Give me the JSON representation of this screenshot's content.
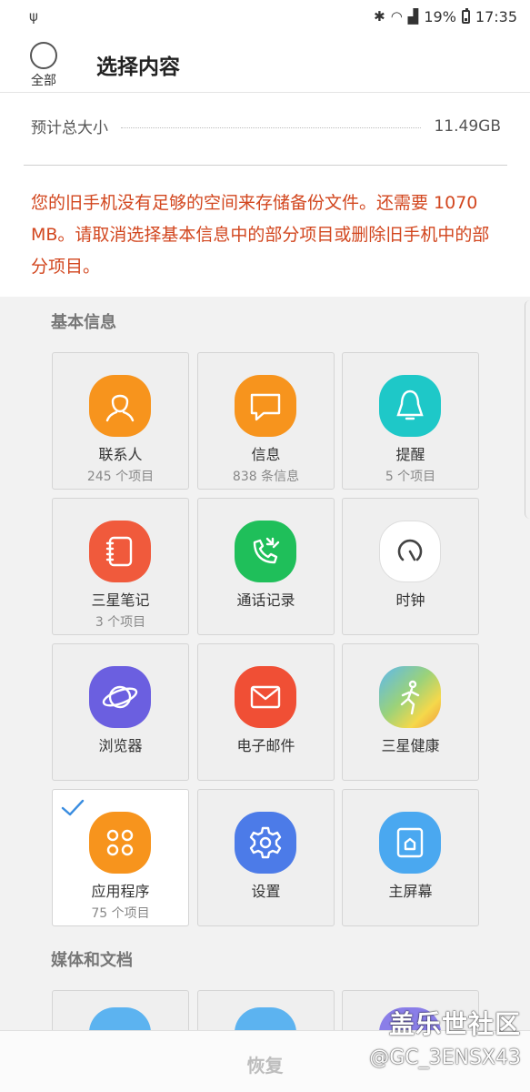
{
  "status_bar": {
    "usb": "ψ",
    "battery": "19%",
    "time": "17:35"
  },
  "header": {
    "select_all_label": "全部",
    "title": "选择内容"
  },
  "size": {
    "label": "预计总大小",
    "value": "11.49GB"
  },
  "warning": "您的旧手机没有足够的空间来存储备份文件。还需要 1070 MB。请取消选择基本信息中的部分项目或删除旧手机中的部分项目。",
  "sections": {
    "basic": "基本信息",
    "media": "媒体和文档"
  },
  "colors": {
    "contacts": "#f7941d",
    "messages": "#f7941d",
    "reminder": "#1ec8c8",
    "notes": "#f05a3c",
    "call_log": "#1fbf5a",
    "clock": "#ffffff",
    "browser": "#6b5fe0",
    "email": "#f04f35",
    "health": "#7ac4e0",
    "apps": "#f7941d",
    "settings": "#4c7be8",
    "home_screen": "#4aa8f0",
    "warning": "#d2461e"
  },
  "tiles": [
    {
      "name": "联系人",
      "count": "245 个项目",
      "icon": "contacts-icon"
    },
    {
      "name": "信息",
      "count": "838 条信息",
      "icon": "message-icon"
    },
    {
      "name": "提醒",
      "count": "5 个项目",
      "icon": "reminder-icon"
    },
    {
      "name": "三星笔记",
      "count": "3 个项目",
      "icon": "notes-icon"
    },
    {
      "name": "通话记录",
      "count": "",
      "icon": "call-log-icon"
    },
    {
      "name": "时钟",
      "count": "",
      "icon": "clock-icon"
    },
    {
      "name": "浏览器",
      "count": "",
      "icon": "browser-icon"
    },
    {
      "name": "电子邮件",
      "count": "",
      "icon": "email-icon"
    },
    {
      "name": "三星健康",
      "count": "",
      "icon": "health-icon"
    },
    {
      "name": "应用程序",
      "count": "75 个项目",
      "icon": "apps-icon"
    },
    {
      "name": "设置",
      "count": "",
      "icon": "settings-icon"
    },
    {
      "name": "主屏幕",
      "count": "",
      "icon": "home-screen-icon"
    }
  ],
  "bottom": {
    "restore_label": "恢复"
  },
  "watermark": {
    "line1": "盖乐世社区",
    "line2": "@GC_3ENSX43"
  }
}
